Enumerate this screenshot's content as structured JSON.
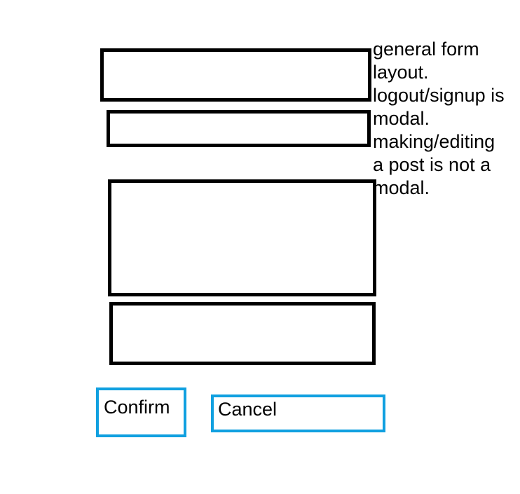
{
  "note": {
    "lines": [
      "general form",
      "layout.",
      "logout/signup is",
      "modal.",
      "making/editing",
      "a post is not a",
      "modal."
    ]
  },
  "buttons": {
    "confirm_label": "Confirm",
    "cancel_label": "Cancel"
  },
  "colors": {
    "field_border": "#000000",
    "button_border": "#10a0e0",
    "background": "#ffffff"
  }
}
